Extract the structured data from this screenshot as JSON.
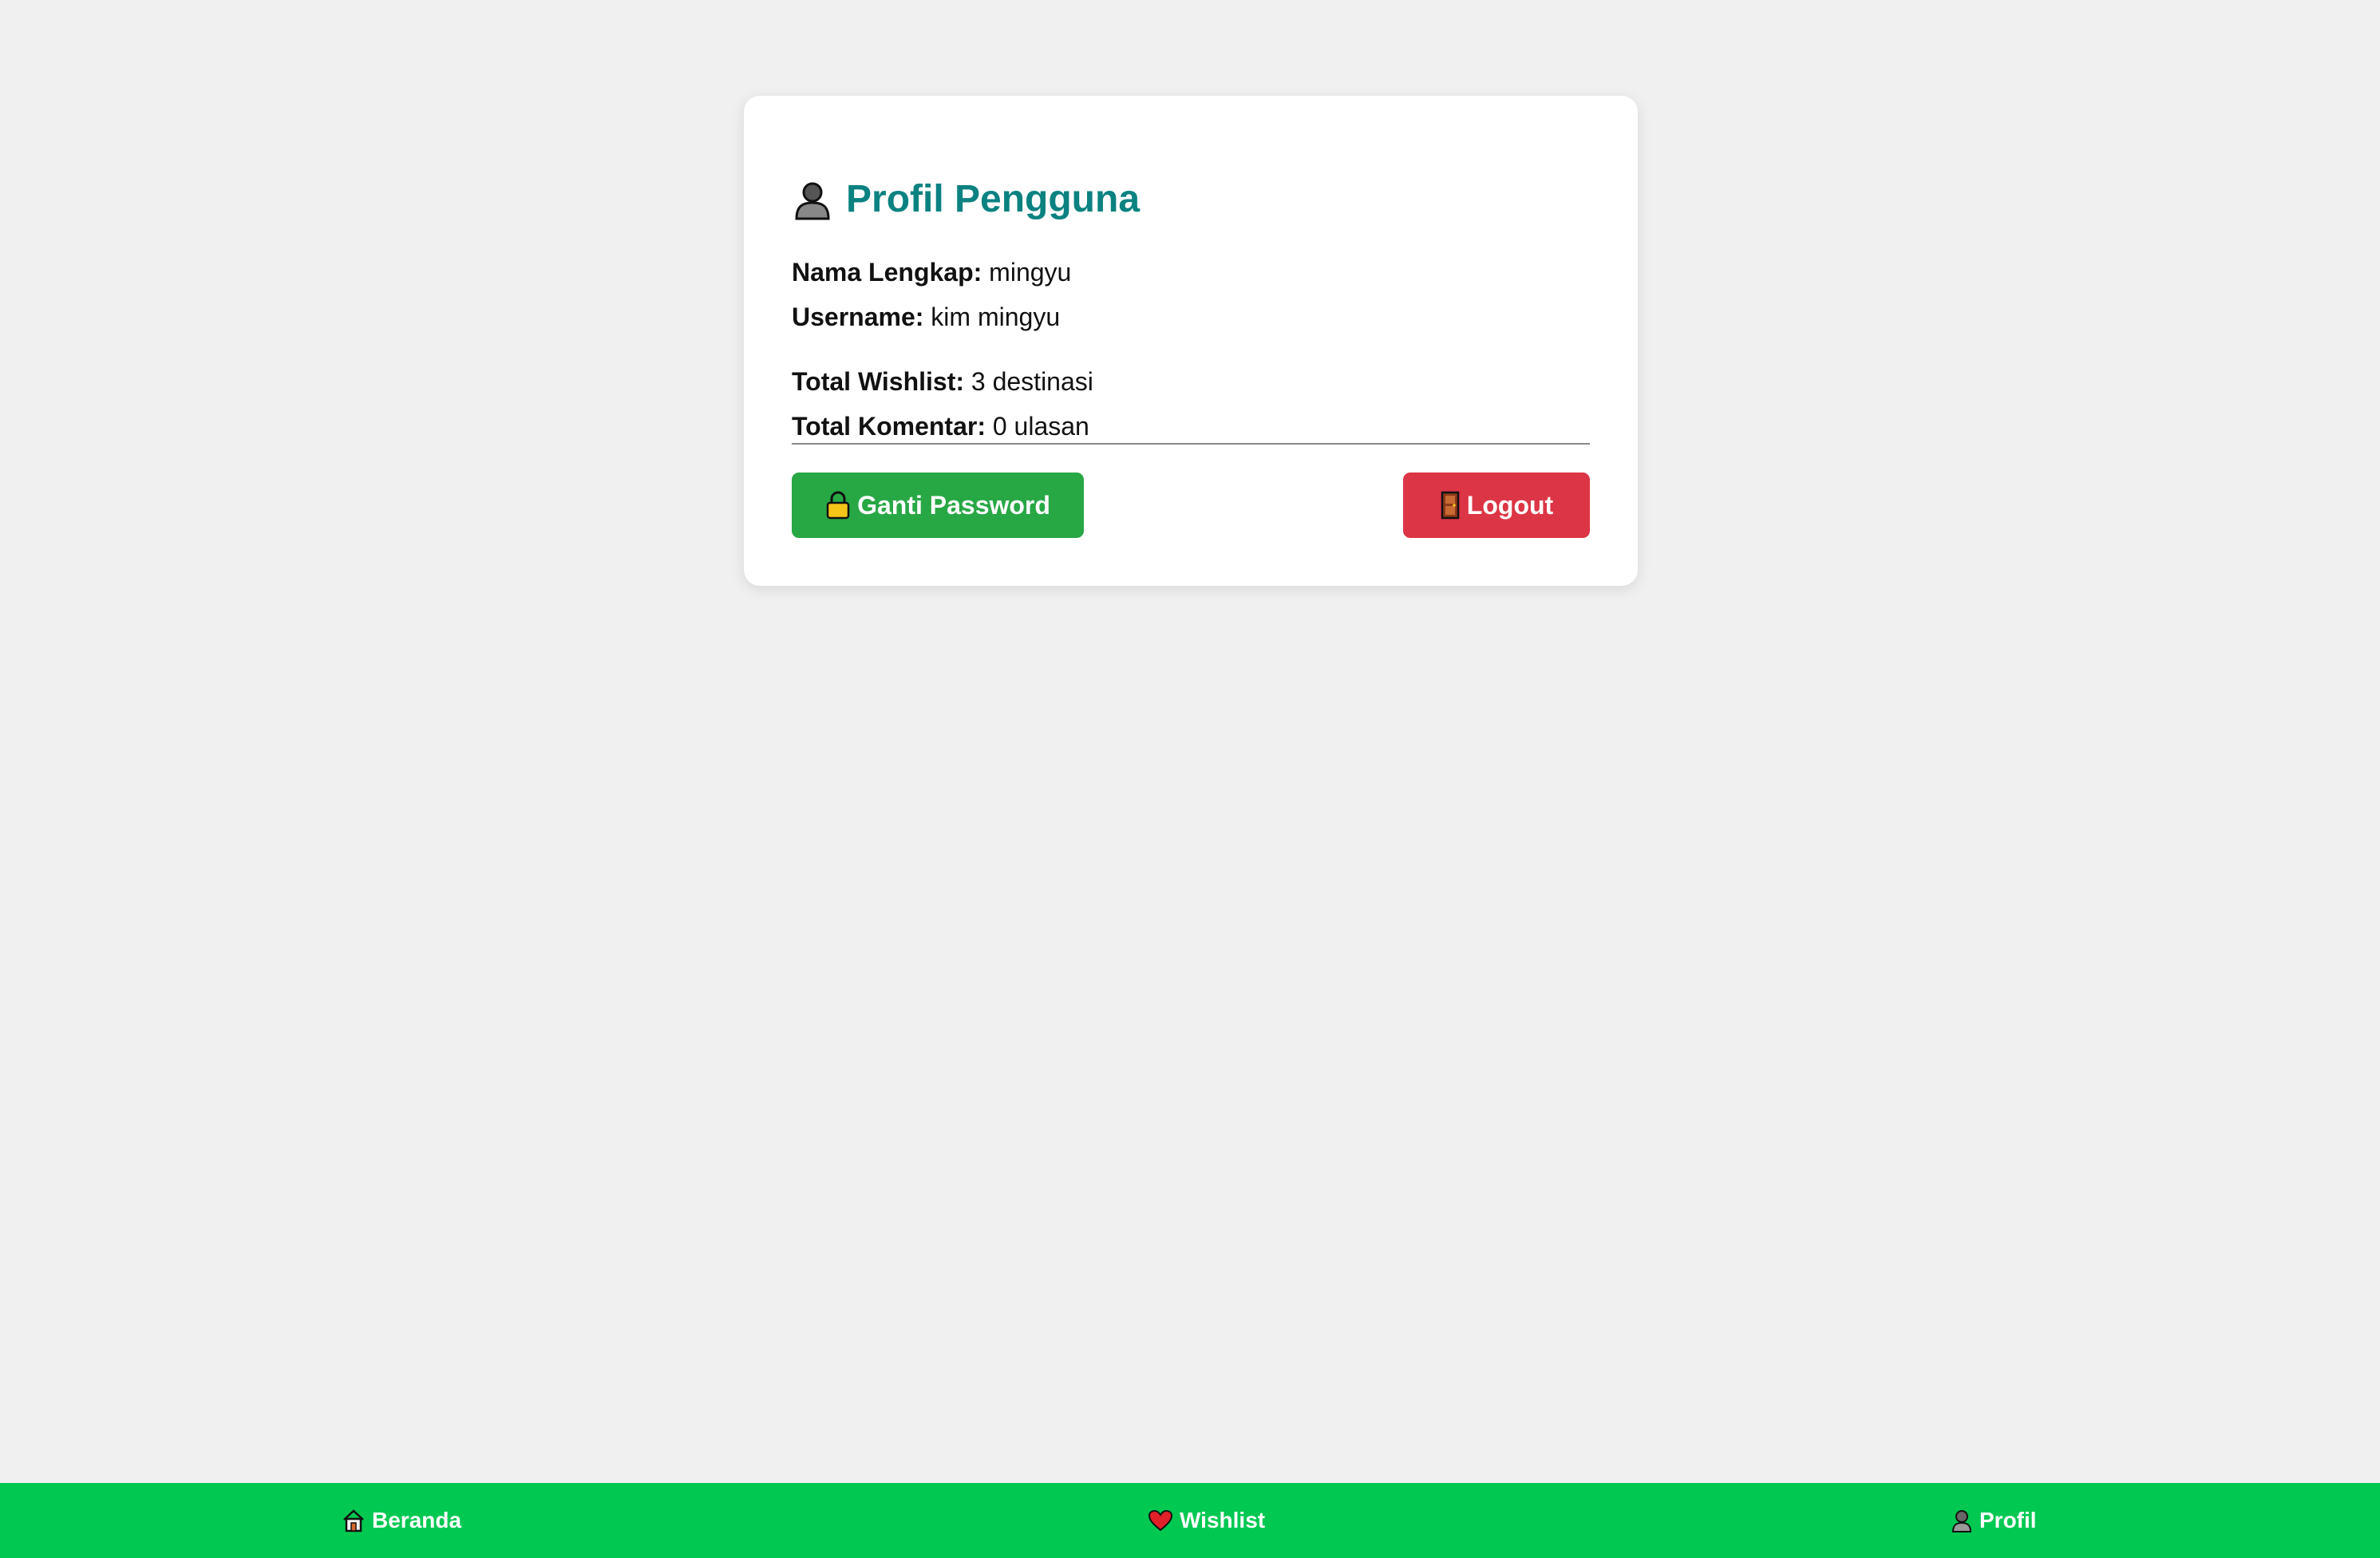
{
  "profile": {
    "title": "Profil Pengguna",
    "title_icon": "user-icon",
    "fields": {
      "full_name_label": "Nama Lengkap:",
      "full_name_value": "mingyu",
      "username_label": "Username:",
      "username_value": "kim mingyu",
      "wishlist_label": "Total Wishlist:",
      "wishlist_value": "3 destinasi",
      "comments_label": "Total Komentar:",
      "comments_value": "0 ulasan"
    },
    "buttons": {
      "change_password": "Ganti Password",
      "logout": "Logout"
    }
  },
  "navbar": {
    "home": "Beranda",
    "wishlist": "Wishlist",
    "profile": "Profil"
  },
  "colors": {
    "background": "#f0f0f0",
    "title": "#0b8281",
    "green_button": "#28a745",
    "red_button": "#dc3545",
    "navbar": "#00c851"
  }
}
